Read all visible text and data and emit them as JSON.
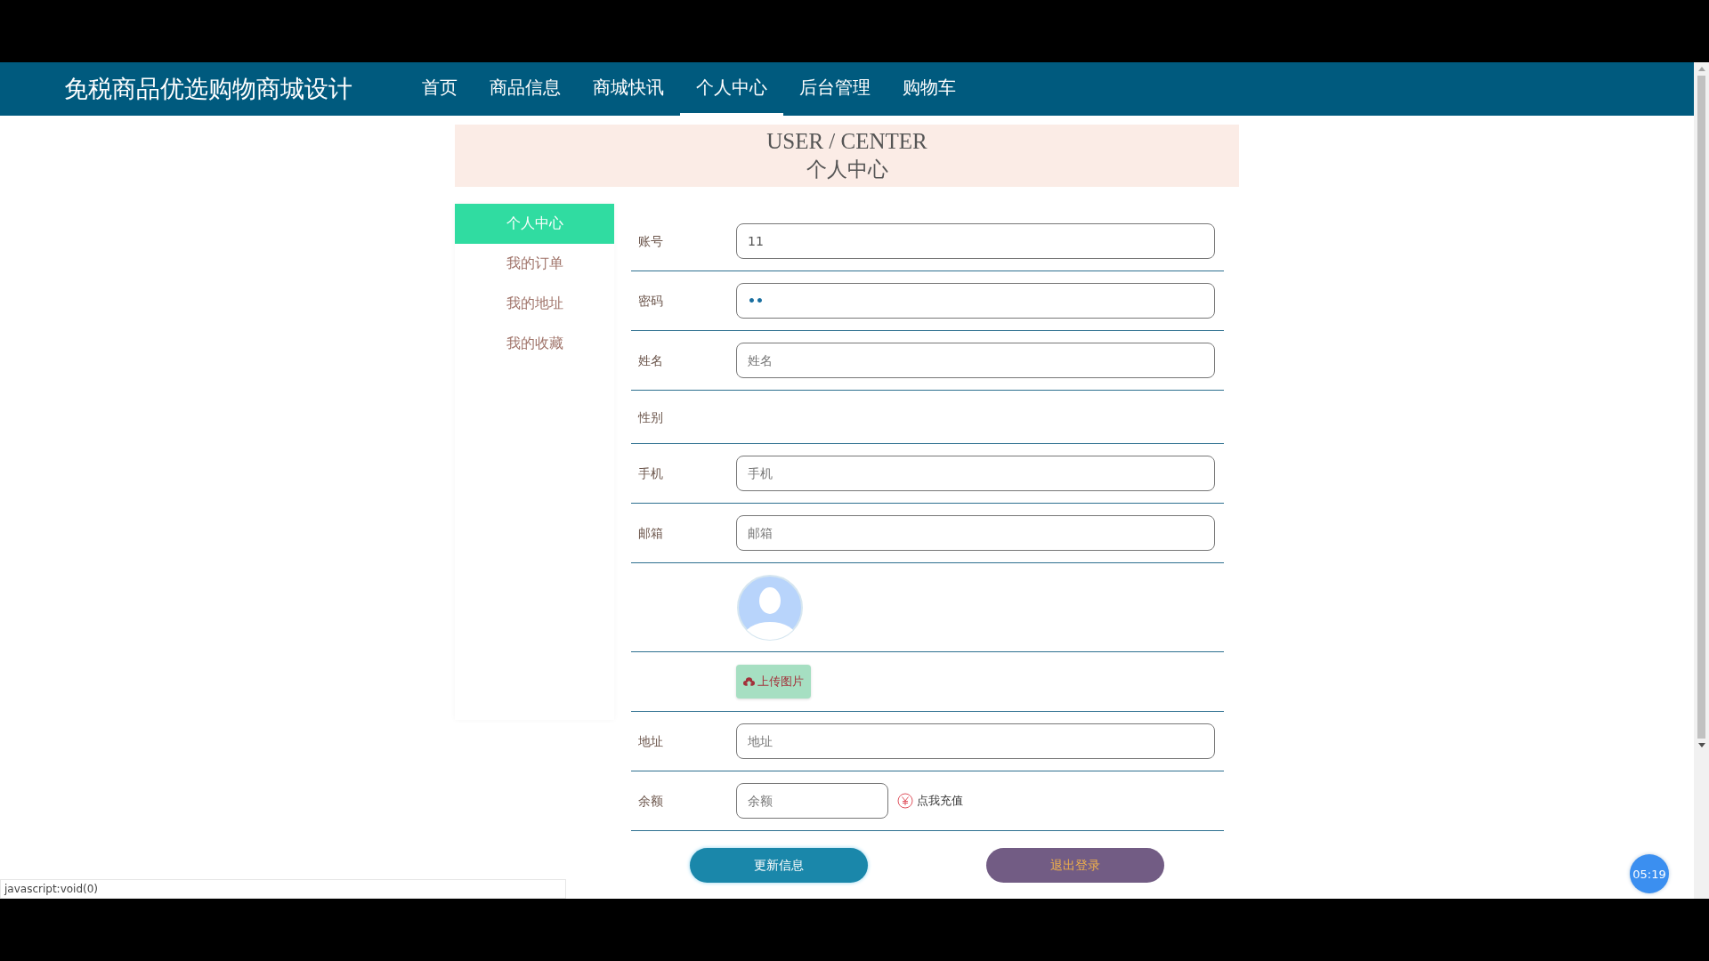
{
  "site_title": "免税商品优选购物商城设计",
  "nav": [
    {
      "label": "首页",
      "selected": false
    },
    {
      "label": "商品信息",
      "selected": false
    },
    {
      "label": "商城快讯",
      "selected": false
    },
    {
      "label": "个人中心",
      "selected": true
    },
    {
      "label": "后台管理",
      "selected": false
    },
    {
      "label": "购物车",
      "selected": false
    }
  ],
  "banner": {
    "title_en": "USER / CENTER",
    "title_cn": "个人中心"
  },
  "sidebar": [
    {
      "label": "个人中心",
      "selected": true
    },
    {
      "label": "我的订单",
      "selected": false
    },
    {
      "label": "我的地址",
      "selected": false
    },
    {
      "label": "我的收藏",
      "selected": false
    }
  ],
  "form": [
    {
      "kind": "text",
      "label": "账号",
      "value": "11"
    },
    {
      "kind": "password",
      "label": "密码",
      "value": "••"
    },
    {
      "kind": "text",
      "label": "姓名",
      "placeholder": "姓名"
    },
    {
      "kind": "empty",
      "label": "性别"
    },
    {
      "kind": "text",
      "label": "手机",
      "placeholder": "手机"
    },
    {
      "kind": "text",
      "label": "邮箱",
      "placeholder": "邮箱"
    },
    {
      "kind": "avatar"
    },
    {
      "kind": "upload",
      "button": "上传图片"
    },
    {
      "kind": "text",
      "label": "地址",
      "placeholder": "地址"
    },
    {
      "kind": "balance",
      "label": "余额",
      "placeholder": "余额",
      "link": "点我充值"
    }
  ],
  "buttons": [
    {
      "kind": "update",
      "label": "更新信息"
    },
    {
      "kind": "logout",
      "label": "退出登录"
    }
  ],
  "status_bar": "javascript:void(0)",
  "timer": "05:19"
}
